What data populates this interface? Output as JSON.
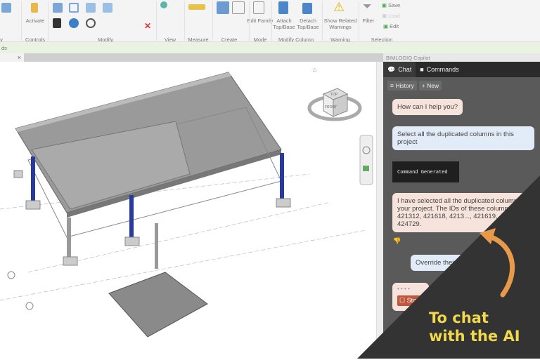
{
  "ribbon": {
    "groups": [
      "y",
      "Controls",
      "Modify",
      "View",
      "Measure",
      "Create",
      "Mode",
      "Modify Column",
      "Warning",
      "Selection"
    ],
    "buttons": {
      "activate": "Activate",
      "edit_family": "Edit Family",
      "attach": "Attach Top/Base",
      "detach": "Detach Top/Base",
      "show_warnings": "Show Related Warnings",
      "filter": "Filter",
      "save": "Save",
      "load": "Load",
      "edit": "Edit"
    }
  },
  "status": {
    "text": "ds"
  },
  "view_tab": {
    "close": "×"
  },
  "viewcube": {
    "top": "TOP",
    "front": "FRONT"
  },
  "panel": {
    "title": "BIMLOGIQ Copilot",
    "tabs": [
      {
        "label": "Chat",
        "icon": "chat-icon"
      },
      {
        "label": "Commands",
        "icon": "save-icon"
      }
    ],
    "history": "History",
    "new": "New",
    "messages": [
      {
        "role": "ai",
        "text": "How can I help you?"
      },
      {
        "role": "user",
        "text": "Select all the duplicated columns in this project"
      },
      {
        "role": "command",
        "text": "Command Generated"
      },
      {
        "role": "ai",
        "text": "I have selected all the duplicated columns in your project. The IDs of these columns are: 421312, 421618, 4213..., 421619, 421319, 424729."
      },
      {
        "role": "user",
        "text": "Override their ..."
      }
    ],
    "stop": "Stop"
  },
  "overlay": {
    "line1": "To chat",
    "line2": "with the AI",
    "accent": "#f0d94a",
    "arrow": "#e89a4a"
  }
}
